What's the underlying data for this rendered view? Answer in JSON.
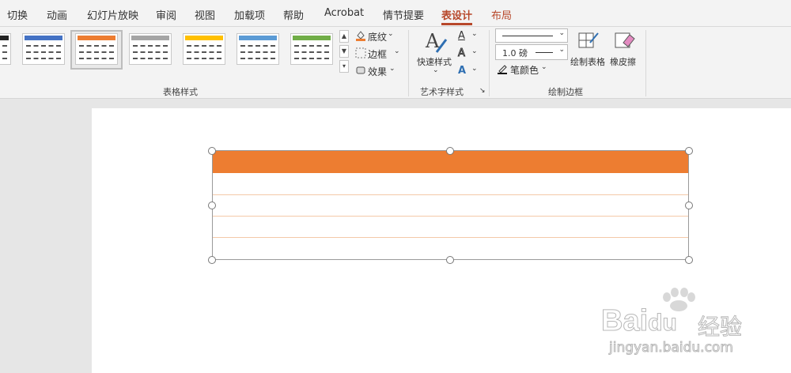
{
  "tabs": [
    "切换",
    "动画",
    "幻灯片放映",
    "审阅",
    "视图",
    "加载项",
    "帮助",
    "Acrobat",
    "情节提要",
    "表设计",
    "布局"
  ],
  "active_tab": "表设计",
  "ribbon": {
    "shading_label": "底纹",
    "border_label": "边框",
    "effects_label": "效果",
    "table_styles_group": "表格样式",
    "quick_styles_label": "快速样式",
    "wordart_group": "艺术字样式",
    "line_weight": "1.0 磅",
    "pen_color_label": "笔颜色",
    "draw_table_label": "绘制表格",
    "eraser_label": "橡皮擦",
    "draw_borders_group": "绘制边框"
  },
  "style_swatch_colors": [
    "#4472c4",
    "#ed7d31",
    "#a5a5a5",
    "#ffc000",
    "#5b9bd5",
    "#70ad47"
  ],
  "table": {
    "header_color": "#ed7d31",
    "row_line_color": "#f4c9a8",
    "rows": 4
  },
  "watermark": {
    "brand": "Bai",
    "brand2": "du",
    "jingyan": "经验",
    "url": "jingyan.baidu.com"
  }
}
